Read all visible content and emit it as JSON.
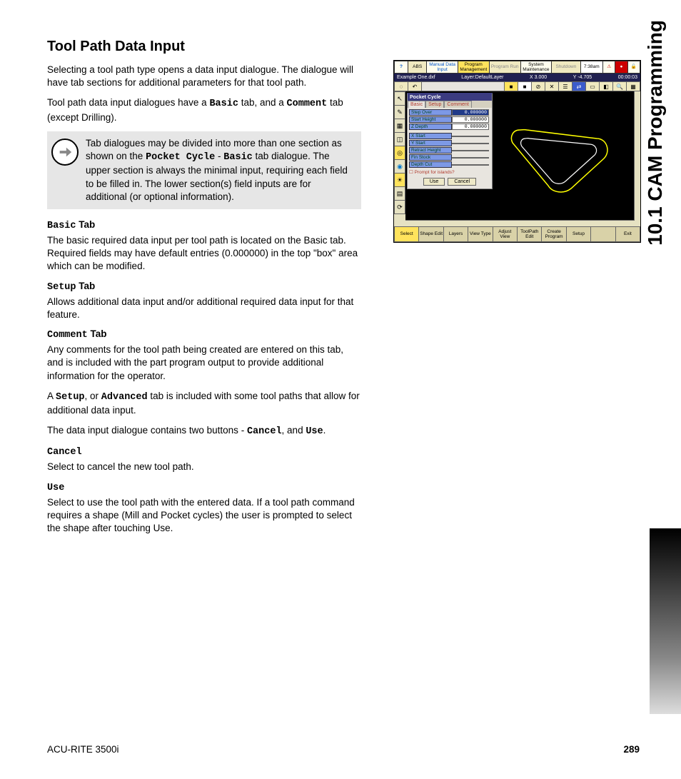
{
  "side_label": "10.1 CAM Programming",
  "title": "Tool Path Data Input",
  "p1": "Selecting a tool path type opens a data input dialogue. The dialogue will have tab sections for additional parameters for that tool path.",
  "p2a": "Tool path data input dialogues have a ",
  "p2b": "Basic",
  "p2c": " tab, and a ",
  "p2d": "Comment",
  "p2e": " tab (except Drilling).",
  "note_a": "Tab dialogues may be divided into more than one section as shown on the ",
  "note_b": "Pocket Cycle",
  "note_c": " - ",
  "note_d": "Basic",
  "note_e": " tab dialogue.  The upper section is always the minimal input, requiring each field to be filled in.  The lower section(s) field inputs are for additional (or optional information).",
  "basic_head_a": "Basic",
  "basic_head_b": " Tab",
  "basic_text": "The basic required data input per tool path is located on the Basic tab. Required fields may have default entries (0.000000) in the top \"box\" area which can be modified.",
  "setup_head_a": "Setup",
  "setup_head_b": " Tab",
  "setup_text": "Allows additional data input and/or additional required data input for that feature.",
  "comment_head_a": "Comment",
  "comment_head_b": " Tab",
  "comment_text": "Any comments for the tool path being created are entered on this tab, and is included with the part program output to provide additional information for the operator.",
  "adv_a": "A ",
  "adv_b": "Setup",
  "adv_c": ", or ",
  "adv_d": "Advanced",
  "adv_e": " tab is included with some tool paths that allow for additional data input.",
  "btns_a": "The data input dialogue contains two buttons - ",
  "btns_b": "Cancel",
  "btns_c": ", and ",
  "btns_d": "Use",
  "btns_e": ".",
  "cancel_head": "Cancel",
  "cancel_text": "Select to cancel the new tool path.",
  "use_head": "Use",
  "use_text": "Select to use the tool path with the entered data. If a tool path command requires a shape (Mill and Pocket cycles) the user is prompted to select the shape after touching Use.",
  "footer_left": "ACU-RITE 3500i",
  "footer_right": "289",
  "shot": {
    "top": {
      "help": "?",
      "abs": "ABS",
      "mdi": "Manual Data Input",
      "pm": "Program Management",
      "run": "Program Run",
      "sys": "System Maintenance",
      "sd": "Shutdown",
      "time": "7:38am"
    },
    "status": {
      "file": "Example One.dxf",
      "layer": "Layer:DefaultLayer",
      "x": "X  3.000",
      "y": "Y  -4.705",
      "t": "00:00:03"
    },
    "dialog": {
      "title": "Pocket Cycle",
      "tabs": [
        "Basic",
        "Setup",
        "Comment"
      ],
      "rows": [
        {
          "label": "Step Over",
          "val": "0.000000",
          "sel": true
        },
        {
          "label": "Start Height",
          "val": "0.000000"
        },
        {
          "label": "Z Depth",
          "val": "0.000000"
        },
        {
          "label": "X Start",
          "val": ""
        },
        {
          "label": "Y Start",
          "val": ""
        },
        {
          "label": "Retract Height",
          "val": ""
        },
        {
          "label": "Fin Stock",
          "val": ""
        },
        {
          "label": "Depth Cut",
          "val": ""
        }
      ],
      "prompt": "Prompt for islands?",
      "use": "Use",
      "cancel": "Cancel"
    },
    "bottom": [
      "Select",
      "Shape Edit",
      "Layers",
      "View Type",
      "Adjust View",
      "ToolPath Edit",
      "Create Program",
      "Setup",
      "",
      "Exit"
    ]
  }
}
